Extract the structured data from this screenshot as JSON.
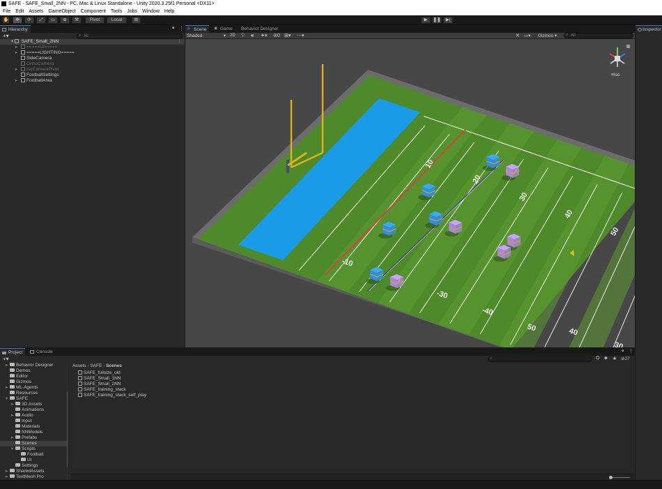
{
  "window": {
    "title": "SAFE - SAFE_Small_2NN - PC, Mac & Linux Standalone - Unity 2020.3.25f1 Personal <DX11>"
  },
  "menu": [
    "File",
    "Edit",
    "Assets",
    "GameObject",
    "Component",
    "Tools",
    "Jobs",
    "Window",
    "Help"
  ],
  "toolbar": {
    "pivot_label": "Pivot",
    "local_label": "Local",
    "play_icon": "play-icon",
    "pause_icon": "pause-icon",
    "step_icon": "step-icon"
  },
  "hierarchy": {
    "tab_label": "Hierarchy",
    "search_placeholder": "All",
    "scene_name": "SAFE_Small_2NN",
    "items": [
      {
        "label": "=====UI=====",
        "dim": true
      },
      {
        "label": "=====LIGHTING=====",
        "dim": false
      },
      {
        "label": "SideCamera",
        "dim": false
      },
      {
        "label": "OrthoCamera",
        "dim": true
      },
      {
        "label": "IsoCameraPivot",
        "dim": true
      },
      {
        "label": "FootballSettings",
        "dim": false
      },
      {
        "label": "FootballArea",
        "dim": false
      }
    ]
  },
  "scene_view": {
    "tabs": [
      "Scene",
      "Game",
      "Behavior Designer"
    ],
    "shading_mode": "Shaded",
    "mode_2d": "2D",
    "gizmos_label": "Gizmos",
    "search_placeholder": "All",
    "projection_label": "Iso",
    "yard_labels": [
      "10",
      "20",
      "30",
      "40",
      "50",
      "-10",
      "-20",
      "-30",
      "-40",
      "50",
      "40",
      "30"
    ]
  },
  "inspector": {
    "tab_label": "Inspector"
  },
  "project": {
    "tabs": [
      "Project",
      "Console"
    ],
    "search_placeholder": "",
    "hidden_count": "27",
    "breadcrumb": [
      "Assets",
      "SAFE",
      "Scenes"
    ],
    "tree": [
      {
        "label": "Behavior Designer",
        "depth": 0
      },
      {
        "label": "Demos",
        "depth": 0
      },
      {
        "label": "Editor",
        "depth": 0
      },
      {
        "label": "Gizmos",
        "depth": 0
      },
      {
        "label": "ML-Agents",
        "depth": 0
      },
      {
        "label": "Resources",
        "depth": 0
      },
      {
        "label": "SAFE",
        "depth": 0
      },
      {
        "label": "3D Assets",
        "depth": 1
      },
      {
        "label": "Animations",
        "depth": 1
      },
      {
        "label": "Audio",
        "depth": 1
      },
      {
        "label": "Input",
        "depth": 1
      },
      {
        "label": "Materials",
        "depth": 1
      },
      {
        "label": "NNModels",
        "depth": 1
      },
      {
        "label": "Prefabs",
        "depth": 1
      },
      {
        "label": "Scenes",
        "depth": 1,
        "selected": true
      },
      {
        "label": "Scripts",
        "depth": 1
      },
      {
        "label": "Football",
        "depth": 2
      },
      {
        "label": "UI",
        "depth": 2
      },
      {
        "label": "Settings",
        "depth": 1
      },
      {
        "label": "SharedAssets",
        "depth": 0
      },
      {
        "label": "TextMesh Pro",
        "depth": 0
      }
    ],
    "files": [
      "SAFE_fullsize_old",
      "SAFE_Small_1NN",
      "SAFE_Small_2NN",
      "SAFE_training_stack",
      "SAFE_training_stack_self_play"
    ]
  },
  "colors": {
    "accent": "#3a79bb",
    "field_green": "#4f8a2a",
    "endzone_blue": "#1a9be8",
    "team_blue": "#2f8ee0",
    "team_purple": "#a887d6",
    "goalpost_yellow": "#e0b01c"
  }
}
